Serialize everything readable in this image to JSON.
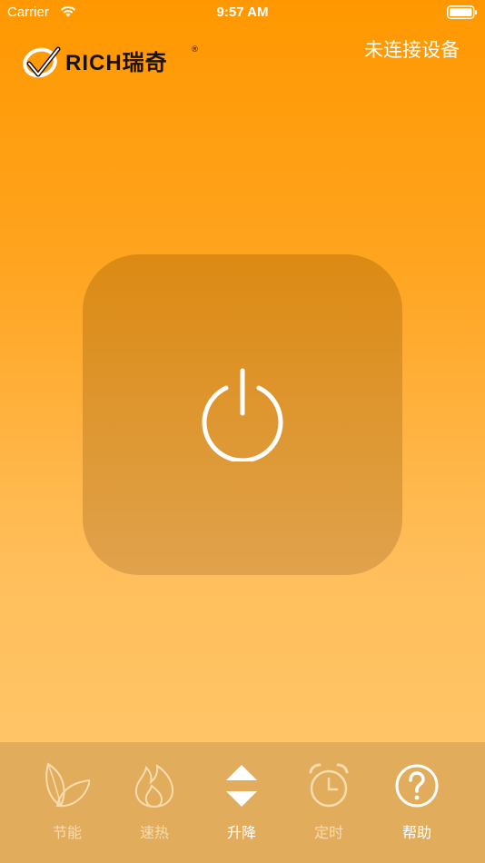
{
  "status_bar": {
    "carrier": "Carrier",
    "time": "9:57 AM"
  },
  "header": {
    "logo_text": "RICH瑞奇",
    "logo_reg": "®",
    "connection_status": "未连接设备"
  },
  "power": {
    "icon": "power-icon"
  },
  "tabs": [
    {
      "label": "节能",
      "icon": "leaf-icon",
      "active": false
    },
    {
      "label": "速热",
      "icon": "flame-icon",
      "active": false
    },
    {
      "label": "升降",
      "icon": "up-down-arrows-icon",
      "active": true
    },
    {
      "label": "定时",
      "icon": "alarm-clock-icon",
      "active": false
    },
    {
      "label": "帮助",
      "icon": "help-icon",
      "active": true
    }
  ],
  "colors": {
    "background_top": "#ff9800",
    "background_bottom": "#ffc96f",
    "panel": "#dc8a13",
    "tab_bar": "#e2ac5d",
    "dim_tab": "#f8dcae"
  }
}
